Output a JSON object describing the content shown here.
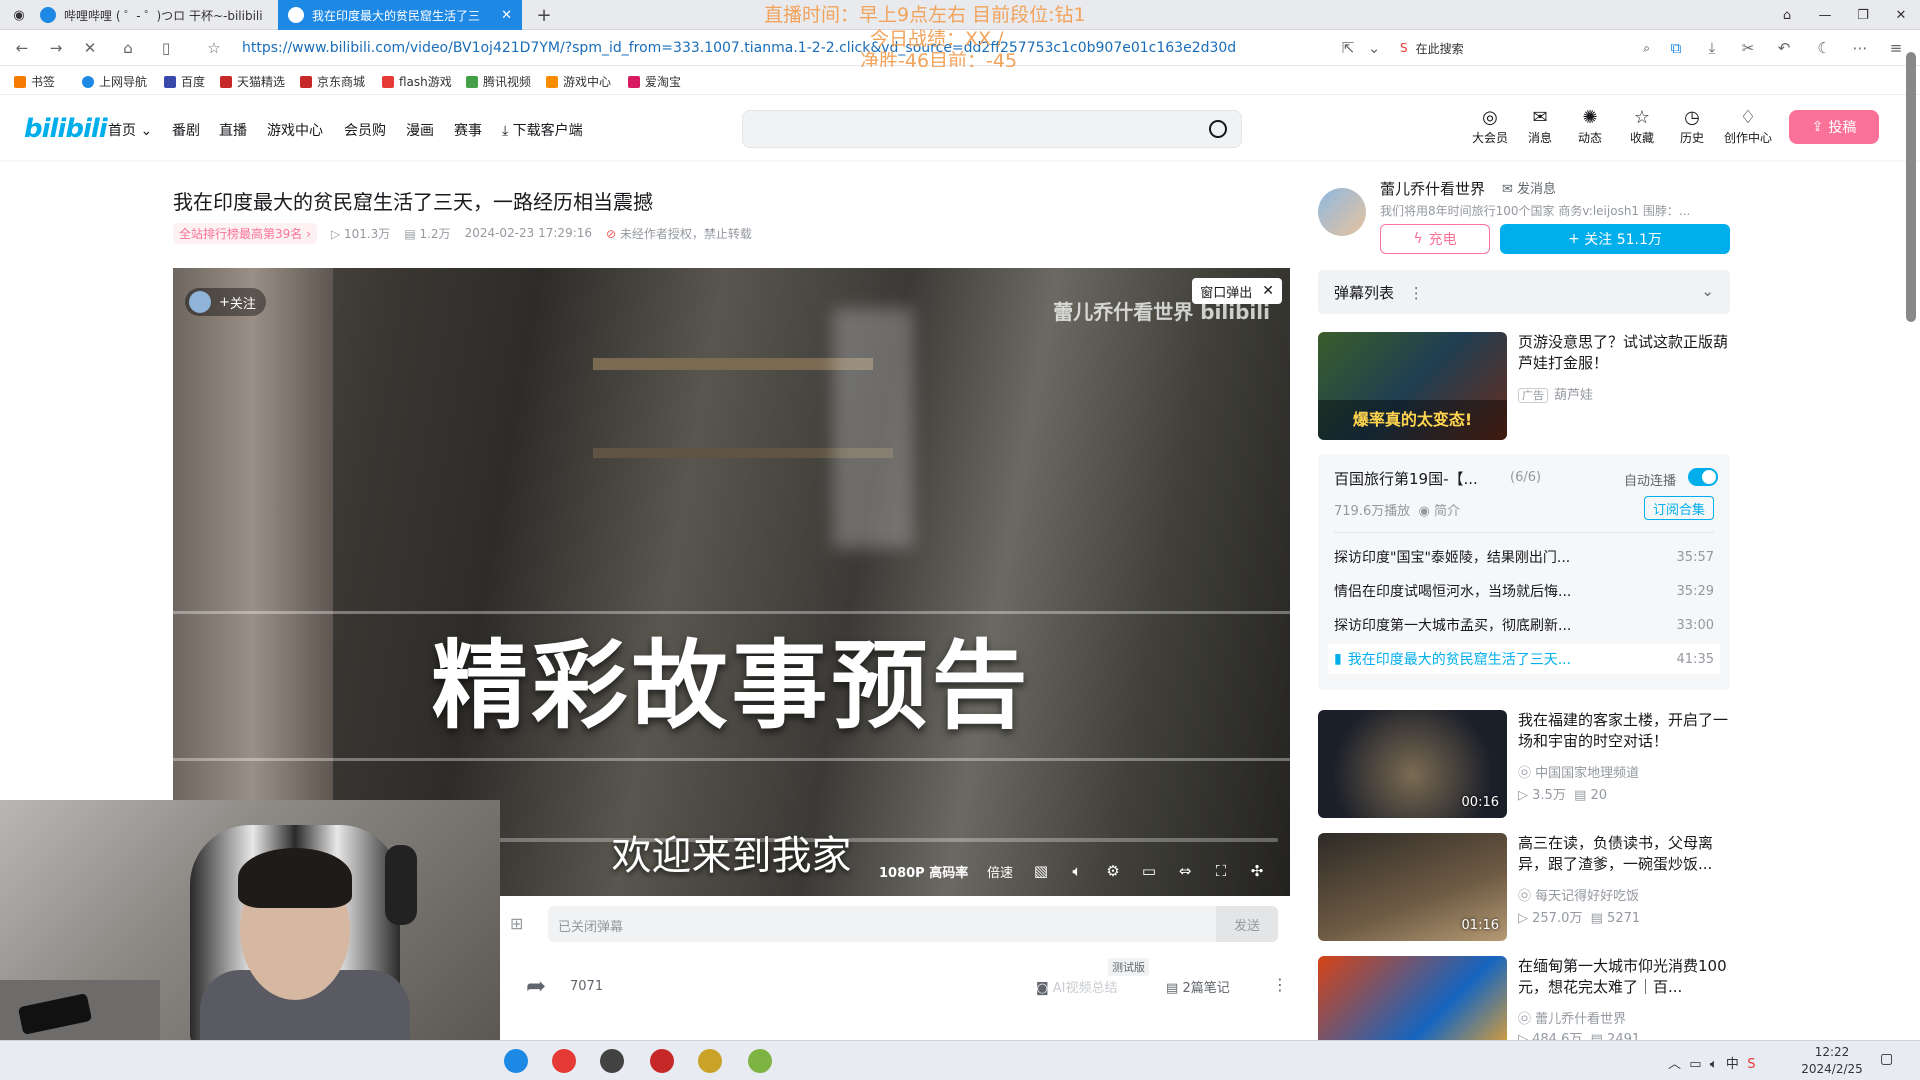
{
  "browser": {
    "tabs": [
      {
        "label": "哔哩哔哩 ( ゜- ゜)つロ 干杯~-bilibili"
      },
      {
        "label": "我在印度最大的贫民窟生活了三"
      }
    ],
    "url": "https://www.bilibili.com/video/BV1oj421D7YM/?spm_id_from=333.1007.tianma.1-2-2.click&vd_source=dd2ff257753c1c0b907e01c163e2d30d",
    "search_placeholder": "在此搜索",
    "bookmarks": [
      "书签",
      "上网导航",
      "百度",
      "天猫精选",
      "京东商城",
      "flash游戏",
      "腾讯视频",
      "游戏中心",
      "爱淘宝"
    ]
  },
  "overlay": {
    "line1": "直播时间：早上9点左右  目前段位:钻1",
    "line2": "今日战绩：XX /",
    "line3": "净胜-46目前：-45"
  },
  "bili_header": {
    "logo": "bilibili",
    "nav": [
      "首页",
      "番剧",
      "直播",
      "游戏中心",
      "会员购",
      "漫画",
      "赛事",
      "下载客户端"
    ],
    "icons": [
      "大会员",
      "消息",
      "动态",
      "收藏",
      "历史",
      "创作中心"
    ],
    "upload": "投稿"
  },
  "video": {
    "title": "我在印度最大的贫民窟生活了三天，一路经历相当震撼",
    "rank": "全站排行榜最高第39名",
    "views": "101.3万",
    "danmaku_count": "1.2万",
    "date": "2024-02-23 17:29:16",
    "copyright": "未经作者授权，禁止转载",
    "big_text": "精彩故事预告",
    "subtitle": "欢迎来到我家",
    "watermark": "蕾儿乔什看世界",
    "popout": "窗口弹出",
    "follow": "关注",
    "quality": "1080P 高码率",
    "speed": "倍速",
    "danmaku_placeholder": "已关闭弹幕",
    "send": "发送",
    "shares": "7071",
    "ai_summary": "AI视频总结",
    "ai_tag": "测试版",
    "notes": "2篇笔记"
  },
  "uploader": {
    "name": "蕾儿乔什看世界",
    "message": "发消息",
    "desc": "我们将用8年时间旅行100个国家 商务v:leijosh1 围脖：...",
    "charge": "充电",
    "follow": "关注 51.1万"
  },
  "danmaku_list": {
    "label": "弹幕列表"
  },
  "ad": {
    "title": "页游没意思了？试试这款正版葫芦娃打金服！",
    "tag": "广告",
    "source": "葫芦娃"
  },
  "collection": {
    "title": "百国旅行第19国-【...",
    "count": "(6/6)",
    "autoplay": "自动连播",
    "plays": "719.6万播放",
    "intro": "简介",
    "subscribe": "订阅合集",
    "episodes": [
      {
        "title": "探访印度\"国宝\"泰姬陵，结果刚出门...",
        "dur": "35:57"
      },
      {
        "title": "情侣在印度试喝恒河水，当场就后悔...",
        "dur": "35:29"
      },
      {
        "title": "探访印度第一大城市孟买，彻底刷新...",
        "dur": "33:00"
      },
      {
        "title": "我在印度最大的贫民窟生活了三天...",
        "dur": "41:35"
      }
    ]
  },
  "recommend": [
    {
      "title": "我在福建的客家土楼，开启了一场和宇宙的时空对话！",
      "up": "中国国家地理频道",
      "views": "3.5万",
      "dm": "20",
      "dur": "00:16"
    },
    {
      "title": "高三在读，负债读书，父母离异，跟了渣爹，一碗蛋炒饭...",
      "up": "每天记得好好吃饭",
      "views": "257.0万",
      "dm": "5271",
      "dur": "01:16"
    },
    {
      "title": "在缅甸第一大城市仰光消费100元，想花完太难了｜百...",
      "up": "蕾儿乔什看世界",
      "views": "484.6万",
      "dm": "2491",
      "dur": ""
    }
  ],
  "taskbar": {
    "time": "12:22",
    "date": "2024/2/25",
    "lang": "中"
  }
}
